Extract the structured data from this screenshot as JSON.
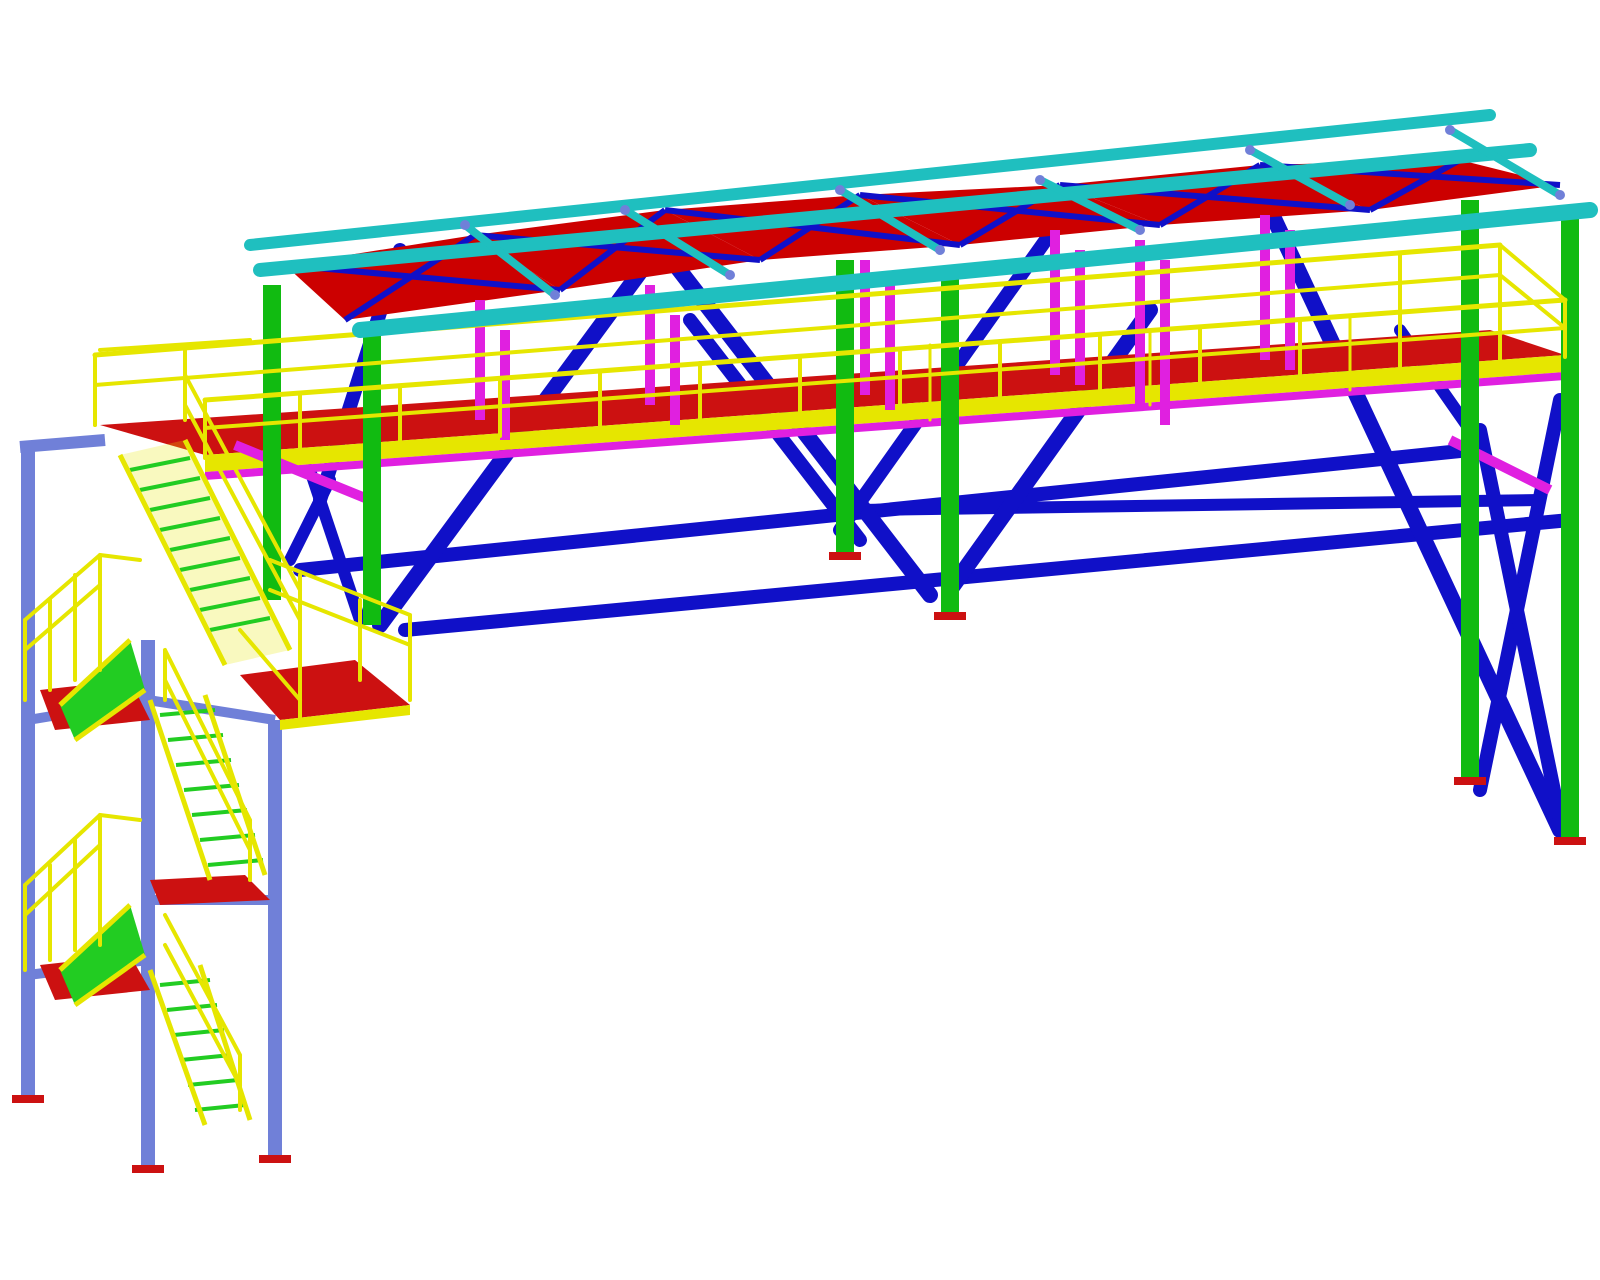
{
  "colors": {
    "background": "#ffffff",
    "roof_beam": "#1fbfbf",
    "roof_plate": "#cc0000",
    "bracing": "#1010c8",
    "column": "#11bb11",
    "purlin_post": "#e020e0",
    "handrail": "#e6e600",
    "deck": "#cc1111",
    "stair_tower": "#7080d8",
    "tread": "#22cc22",
    "base_plate": "#cc1111",
    "outline": "#333333"
  },
  "legend": [],
  "components": [
    "roof-frame",
    "walkway-deck",
    "handrails",
    "bracing",
    "columns",
    "stair-tower",
    "stair-flights",
    "base-plates"
  ]
}
